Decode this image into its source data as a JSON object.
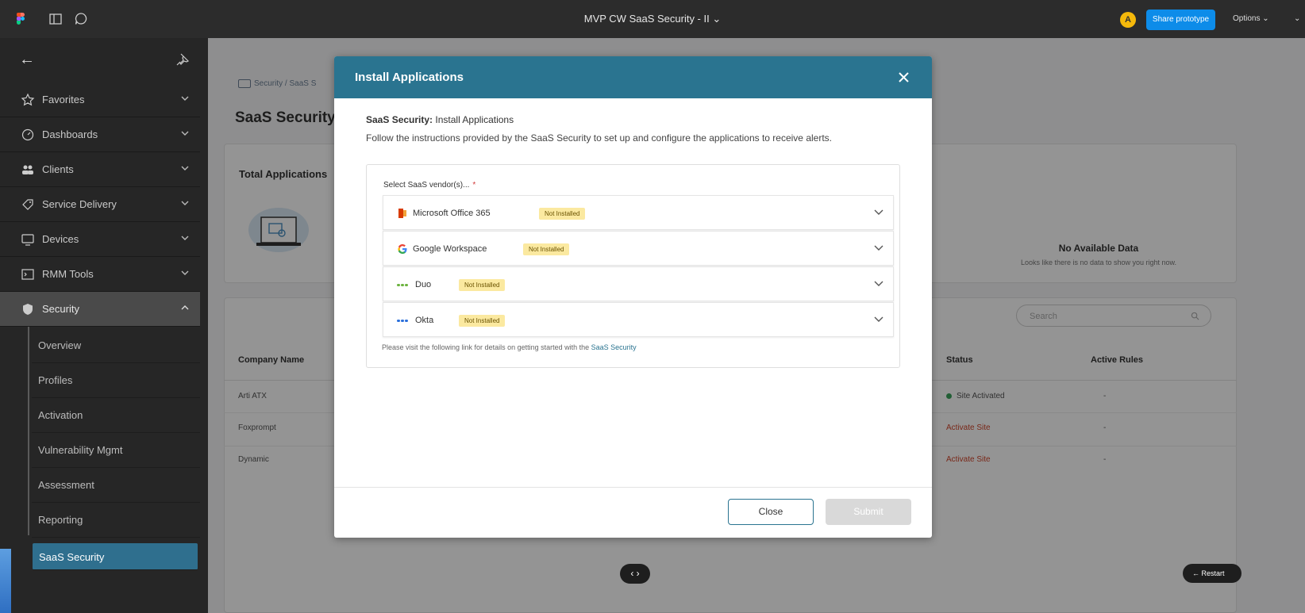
{
  "figma": {
    "title": "MVP CW SaaS Security - II",
    "avatar_initial": "A",
    "share_label": "Share prototype",
    "options_label": "Options"
  },
  "sidebar": {
    "items": [
      {
        "label": "Favorites",
        "icon": "star-icon"
      },
      {
        "label": "Dashboards",
        "icon": "gauge-icon"
      },
      {
        "label": "Clients",
        "icon": "users-icon"
      },
      {
        "label": "Service Delivery",
        "icon": "tag-icon"
      },
      {
        "label": "Devices",
        "icon": "monitor-icon"
      },
      {
        "label": "RMM Tools",
        "icon": "terminal-icon"
      },
      {
        "label": "Security",
        "icon": "shield-icon"
      }
    ],
    "sub_items": [
      "Overview",
      "Profiles",
      "Activation",
      "Vulnerability Mgmt",
      "Assessment",
      "Reporting",
      "SaaS Security"
    ]
  },
  "page": {
    "breadcrumb": "Security / SaaS S",
    "title": "SaaS Security",
    "total_apps_label": "Total Applications",
    "no_data_title": "No Available Data",
    "no_data_sub": "Looks like there is no data to show you right now.",
    "search_placeholder": "Search",
    "columns": {
      "company": "Company Name",
      "status": "Status",
      "rules": "Active Rules"
    },
    "rows": [
      {
        "company": "Arti ATX",
        "status": "Site Activated",
        "rules": "-"
      },
      {
        "company": "Foxprompt",
        "status": "Activate Site",
        "rules": "-"
      },
      {
        "company": "Dynamic",
        "status": "Activate Site",
        "rules": "-"
      }
    ]
  },
  "modal": {
    "title": "Install Applications",
    "subtitle_bold": "SaaS Security:",
    "subtitle_rest": " Install Applications",
    "description": "Follow the instructions provided by the SaaS Security to set up and configure the applications to receive alerts.",
    "vendor_label": "Select SaaS vendor(s)...",
    "required_mark": "*",
    "vendors": [
      {
        "name": "Microsoft Office 365",
        "status": "Not Installed"
      },
      {
        "name": "Google Workspace",
        "status": "Not Installed"
      },
      {
        "name": "Duo",
        "status": "Not Installed"
      },
      {
        "name": "Okta",
        "status": "Not Installed"
      }
    ],
    "help_text": "Please visit the following link for details on getting started with the ",
    "help_link": "SaaS Security",
    "close_label": "Close",
    "submit_label": "Submit"
  },
  "controls": {
    "nav": "‹ ›",
    "restart": "← Restart"
  },
  "colors": {
    "header": "#2a7490",
    "badge": "#fbe9a0",
    "sidebar_selected": "#2f6f8e",
    "activate": "#d0452b"
  }
}
